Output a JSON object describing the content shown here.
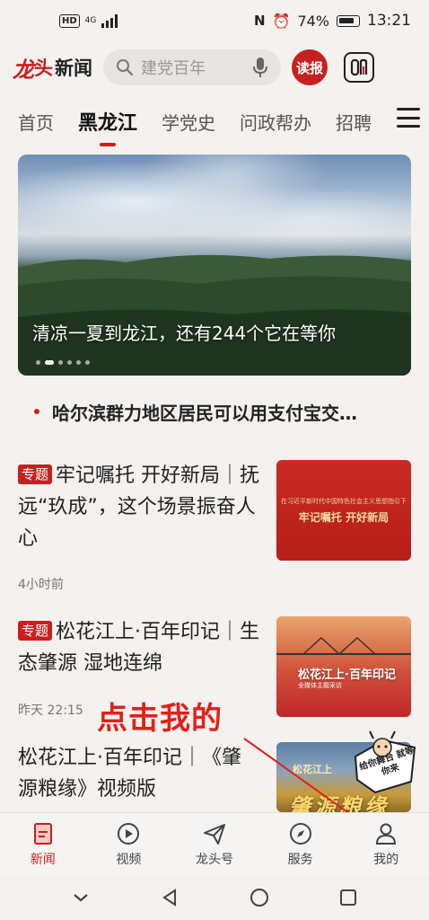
{
  "status_bar": {
    "hd": "HD",
    "network": "4G",
    "battery": "74%",
    "time": "13:21"
  },
  "header": {
    "logo_part1": "龙",
    "logo_part2": "头",
    "logo_part3": "新闻",
    "search_placeholder": "建党百年",
    "dubao_label": "读报",
    "apps_label": "0♪"
  },
  "tabs": [
    {
      "label": "首页",
      "active": false
    },
    {
      "label": "黑龙江",
      "active": true
    },
    {
      "label": "学党史",
      "active": false
    },
    {
      "label": "问政帮办",
      "active": false
    },
    {
      "label": "招聘",
      "active": false
    }
  ],
  "banner": {
    "caption": "清凉一夏到龙江，还有244个它在等你"
  },
  "headline": "哈尔滨群力地区居民可以用支付宝交…",
  "news": [
    {
      "tag": "专题",
      "title": "牢记嘱托  开好新局｜抚远“玖成”，这个场景振奋人心",
      "meta": "4小时前",
      "thumb_small": "在习近平新时代中国特色社会主义思想指引下",
      "thumb_big": "牢记嘱托 开好新局"
    },
    {
      "tag": "专题",
      "title": "松花江上·百年印记｜生态肇源  湿地连绵",
      "meta": "昨天  22:15",
      "thumb_title": "松花江上·百年印记",
      "thumb_sub": "全媒体主题采访"
    },
    {
      "title": "松花江上·百年印记｜《肇源粮缘》视频版",
      "thumb_title": "松花江上",
      "thumb_big": "肇源粮缘"
    }
  ],
  "annotation": "点击我的",
  "sticker_text": "给你舞台 就等你来",
  "bottom_nav": [
    {
      "label": "新闻",
      "icon": "news-icon",
      "active": true
    },
    {
      "label": "视频",
      "icon": "video-icon",
      "active": false
    },
    {
      "label": "龙头号",
      "icon": "paper-plane-icon",
      "active": false
    },
    {
      "label": "服务",
      "icon": "compass-icon",
      "active": false
    },
    {
      "label": "我的",
      "icon": "user-icon",
      "active": false
    }
  ],
  "colors": {
    "brand": "#c8201e",
    "background": "#f4f1ee",
    "annotation": "#e0211a"
  }
}
